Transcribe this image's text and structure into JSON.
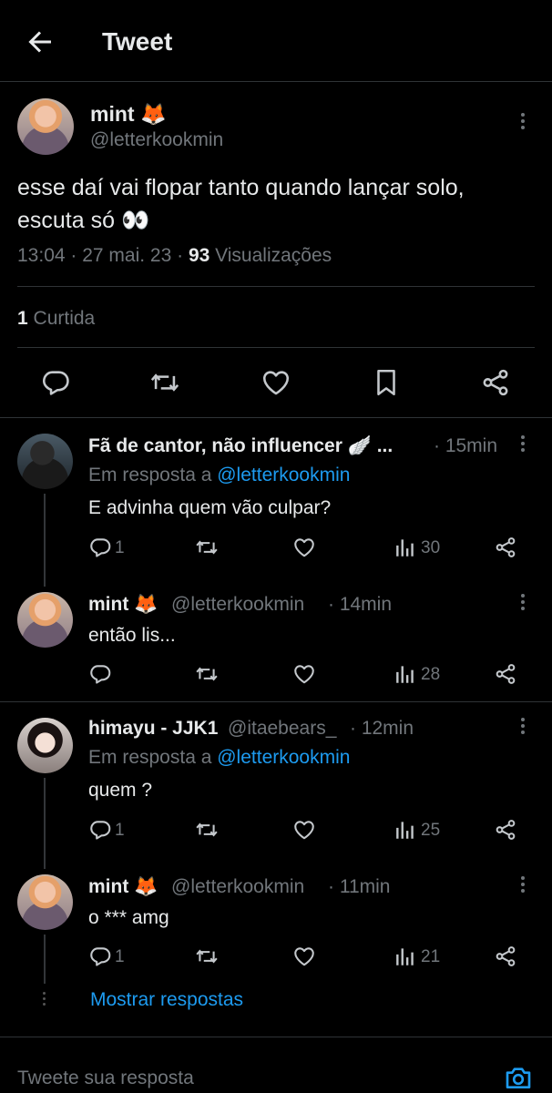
{
  "header": {
    "title": "Tweet"
  },
  "tweet": {
    "name": "mint 🦊",
    "handle": "@letterkookmin",
    "text_line1": "esse daí vai flopar tanto quando lançar solo,",
    "text_line2": "escuta só 👀",
    "time": "13:04 · 27 mai. 23 · ",
    "views_count": "93",
    "views_label": " Visualizações",
    "likes_count": "1",
    "likes_label": " Curtida"
  },
  "replies": [
    {
      "name": "Fã de cantor, não influencer 🪽 ...",
      "time": "· 15min",
      "reply_to_label": "Em resposta a ",
      "reply_to_handle": "@letterkookmin",
      "text": "E advinha quem vão culpar?",
      "reply_count": "1",
      "views": "30"
    },
    {
      "name": "mint 🦊",
      "handle": "@letterkookmin",
      "time": "· 14min",
      "text": "então lis...",
      "reply_count": "",
      "views": "28"
    },
    {
      "name": "himayu - JJK1",
      "handle": "@itaebears_",
      "time": "· 12min",
      "reply_to_label": "Em resposta a ",
      "reply_to_handle": "@letterkookmin",
      "text": "quem ?",
      "reply_count": "1",
      "views": "25"
    },
    {
      "name": "mint 🦊",
      "handle": "@letterkookmin",
      "time": "· 11min",
      "text": "o *** amg",
      "reply_count": "1",
      "views": "21"
    }
  ],
  "show_replies": "Mostrar respostas",
  "composer": {
    "placeholder": "Tweete sua resposta"
  },
  "colors": {
    "accent": "#1d9bf0",
    "muted": "#71767b",
    "text": "#e7e9ea",
    "background": "#000000",
    "border": "#2f3336"
  }
}
